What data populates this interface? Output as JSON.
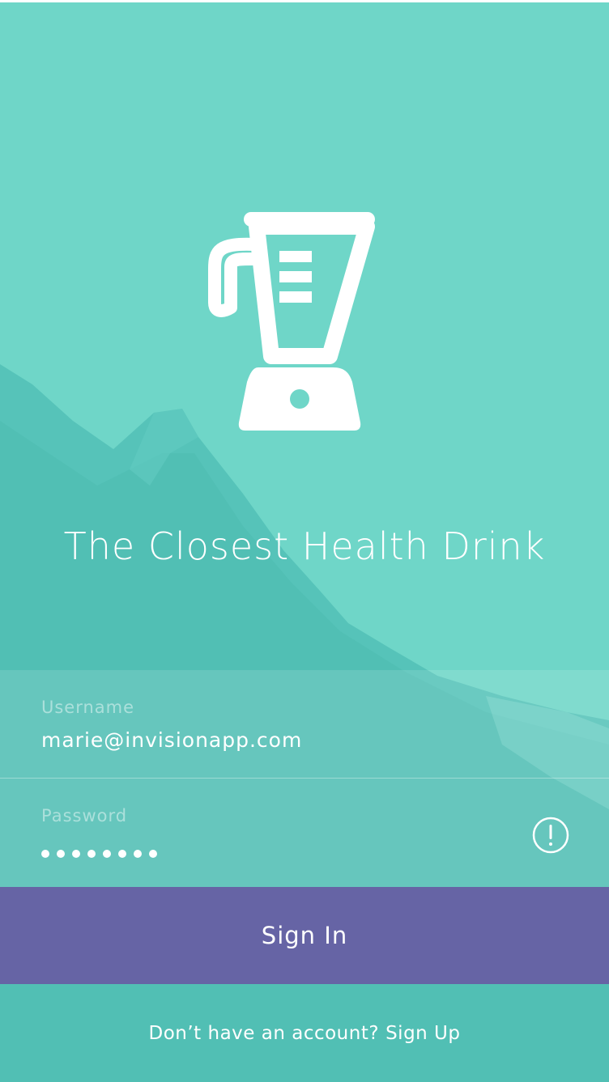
{
  "app": {
    "title": "The Closest Health Drink",
    "logo_icon": "blender-icon"
  },
  "colors": {
    "background": "#6fd6c8",
    "mountain": "#4fbdb4",
    "button": "#6664a5",
    "text": "#ffffff"
  },
  "form": {
    "username": {
      "label": "Username",
      "value": "marie@invisionapp.com"
    },
    "password": {
      "label": "Password",
      "masked_length": 8,
      "status_icon": "alert-icon"
    }
  },
  "actions": {
    "sign_in_label": "Sign In"
  },
  "footer": {
    "prompt": "Don’t have an account?",
    "link_label": "Sign Up"
  }
}
